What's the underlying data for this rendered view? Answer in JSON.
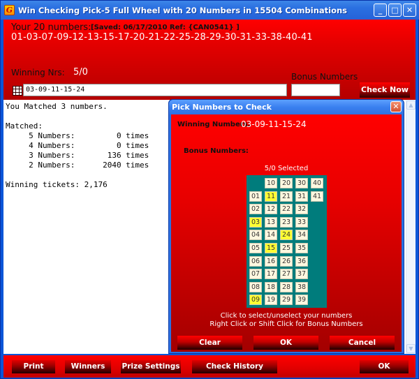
{
  "window": {
    "title": "Win Checking Pick-5 Full Wheel with 20 Numbers in 15504 Combinations",
    "icon_letter": "G",
    "minimize": "_",
    "maximize": "□",
    "close": "✕"
  },
  "header": {
    "your_numbers_label": "Your 20 numbers:",
    "saved_info": "[Saved: 06/17/2010 Ref: {CAN0541} ]",
    "numbers": "01-03-07-09-12-13-15-17-20-21-22-25-28-29-30-31-33-38-40-41",
    "winning_label": "Winning Nrs:",
    "winning_count": "5/0",
    "bonus_label": "Bonus Numbers",
    "winning_input_value": "03-09-11-15-24",
    "bonus_input_value": "",
    "check_now": "Check Now"
  },
  "results": {
    "lines": [
      "You Matched 3 numbers.",
      "",
      "Matched:",
      "     5 Numbers:         0 times",
      "     4 Numbers:         0 times",
      "     3 Numbers:       136 times",
      "     2 Numbers:      2040 times",
      "",
      "Winning tickets: 2,176"
    ]
  },
  "scrollbar": {
    "up": "▲",
    "down": "▼"
  },
  "dialog": {
    "title": "Pick Numbers to Check",
    "close": "✕",
    "winning_label": "Winning Numbers:",
    "winning_value": "03-09-11-15-24",
    "bonus_label": "Bonus Numbers:",
    "selected_count": "5/0 Selected",
    "grid": {
      "columns": [
        [
          "01",
          "02",
          "03",
          "04",
          "05",
          "06",
          "07",
          "08",
          "09"
        ],
        [
          "10",
          "11",
          "12",
          "13",
          "14",
          "15",
          "16",
          "17",
          "18",
          "19"
        ],
        [
          "20",
          "21",
          "22",
          "23",
          "24",
          "25",
          "26",
          "27",
          "28",
          "29"
        ],
        [
          "30",
          "31",
          "32",
          "33",
          "34",
          "35",
          "36",
          "37",
          "38",
          "39"
        ],
        [
          "40",
          "41"
        ]
      ],
      "selected": [
        "03",
        "09",
        "11",
        "15",
        "24"
      ]
    },
    "hint_line1": "Click to select/unselect your numbers",
    "hint_line2": "Right Click or Shift Click for Bonus Numbers",
    "buttons": {
      "clear": "Clear",
      "ok": "OK",
      "cancel": "Cancel"
    }
  },
  "bottom_bar": {
    "print": "Print",
    "winners": "Winners",
    "prize_settings": "Prize Settings",
    "check_history": "Check History",
    "ok": "OK"
  }
}
